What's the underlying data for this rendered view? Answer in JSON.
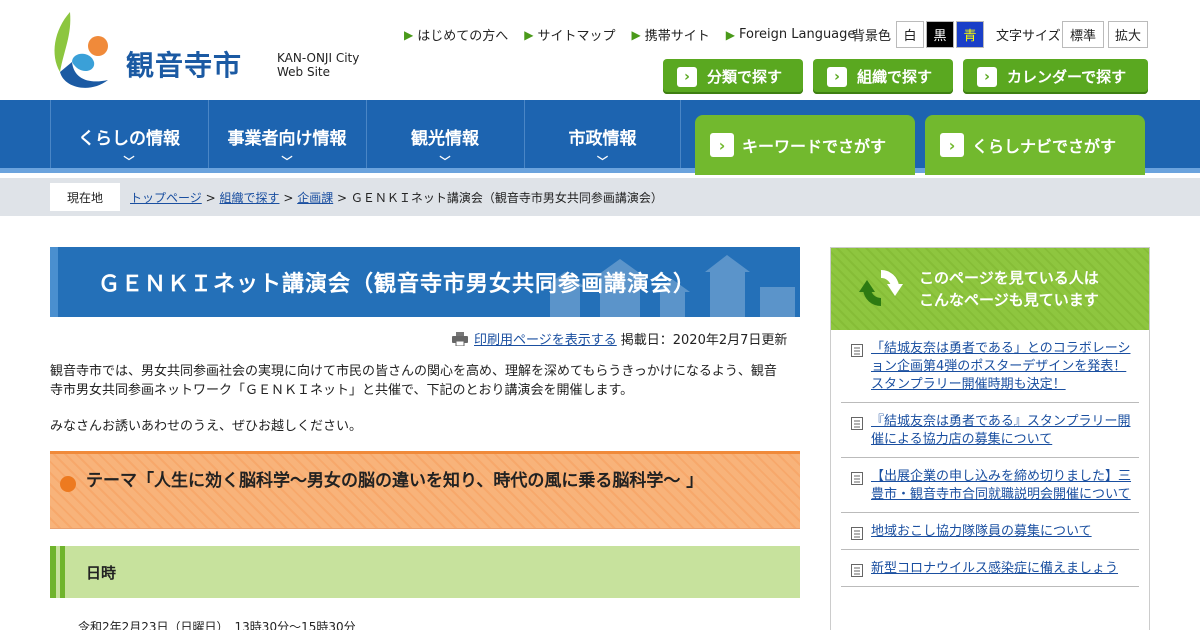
{
  "header": {
    "site_title": "観音寺市",
    "site_sub_line1": "KAN-ONJI City",
    "site_sub_line2": "Web Site",
    "top_links": [
      "はじめての方へ",
      "サイトマップ",
      "携帯サイト",
      "Foreign Language"
    ],
    "bg_label": "背景色",
    "bg_options": [
      "白",
      "黒",
      "青"
    ],
    "font_label": "文字サイズ",
    "font_options": [
      "標準",
      "拡大"
    ],
    "find_buttons": [
      "分類で探す",
      "組織で探す",
      "カレンダーで探す"
    ],
    "accent_green": "#5aa820",
    "brand_blue": "#1d64b0"
  },
  "nav": {
    "items": [
      "くらしの情報",
      "事業者向け情報",
      "観光情報",
      "市政情報"
    ],
    "search_tabs": [
      "キーワードでさがす",
      "くらしナビでさがす"
    ]
  },
  "breadcrumb": {
    "here_label": "現在地",
    "links": [
      "トップページ",
      "組織で探す",
      "企画課"
    ],
    "current": "ＧＥＮＫＩネット講演会（観音寺市男女共同参画講演会）"
  },
  "main": {
    "title": "ＧＥＮＫＩネット講演会（観音寺市男女共同参画講演会）",
    "print_link": "印刷用ページを表示する",
    "posted": "掲載日：2020年2月7日更新",
    "para1": "観音寺市では、男女共同参画社会の実現に向けて市民の皆さんの関心を高め、理解を深めてもらうきっかけになるよう、観音寺市男女共同参画ネットワーク「ＧＥＮＫＩネット」と共催で、下記のとおり講演会を開催します。",
    "para2": "みなさんお誘いあわせのうえ、ぜひお越しください。",
    "theme": "テーマ「人生に効く脳科学～男女の脳の違いを知り、時代の風に乗る脳科学～ 」",
    "section_heading": "日時",
    "date_text": "令和2年2月23日（日曜日）　13時30分～15時30分"
  },
  "sidebar": {
    "heading_line1": "このページを見ている人は",
    "heading_line2": "こんなページも見ています",
    "items": [
      "「結城友奈は勇者である」とのコラボレーション企画第4弾のポスターデザインを発表！スタンプラリー開催時期も決定！",
      "『結城友奈は勇者である』スタンプラリー開催による協力店の募集について",
      "【出展企業の申し込みを締め切りました】三豊市・観音寺市合同就職説明会開催について",
      "地域おこし協力隊隊員の募集について",
      "新型コロナウイルス感染症に備えましょう"
    ]
  }
}
